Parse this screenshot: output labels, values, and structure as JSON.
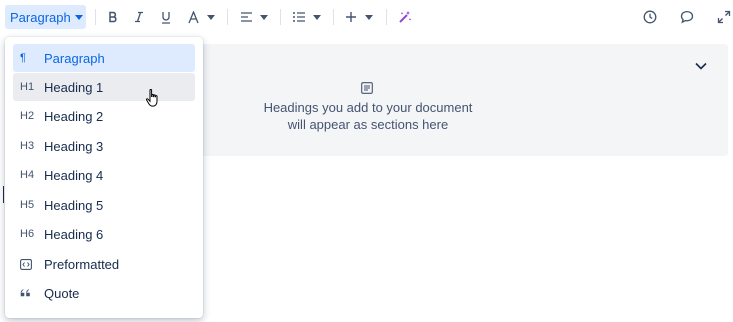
{
  "toolbar": {
    "text_style_label": "Paragraph",
    "icons": [
      "bold-icon",
      "italic-icon",
      "underline-icon",
      "text-color-icon",
      "align-left-icon",
      "bullet-list-icon",
      "insert-plus-icon",
      "ai-magic-wand-icon",
      "history-clock-icon",
      "comment-icon",
      "fullscreen-icon"
    ]
  },
  "toc": {
    "line1": "Headings you add to your document",
    "line2": "will appear as sections here"
  },
  "dropdown": {
    "items": [
      {
        "icon": "¶",
        "label": "Paragraph",
        "state": "selected"
      },
      {
        "icon": "H1",
        "label": "Heading 1",
        "state": "hover"
      },
      {
        "icon": "H2",
        "label": "Heading 2",
        "state": ""
      },
      {
        "icon": "H3",
        "label": "Heading 3",
        "state": ""
      },
      {
        "icon": "H4",
        "label": "Heading 4",
        "state": ""
      },
      {
        "icon": "H5",
        "label": "Heading 5",
        "state": ""
      },
      {
        "icon": "H6",
        "label": "Heading 6",
        "state": ""
      },
      {
        "icon": "preformatted-code-icon",
        "label": "Preformatted",
        "state": ""
      },
      {
        "icon": "quote-icon",
        "label": "Quote",
        "state": ""
      }
    ]
  },
  "colors": {
    "accent": "#0c66e4",
    "selected_bg": "#deebff",
    "hover_bg": "#ebecf0",
    "panel_bg": "#f4f5f7",
    "ai_purple": "#8f49d8"
  }
}
